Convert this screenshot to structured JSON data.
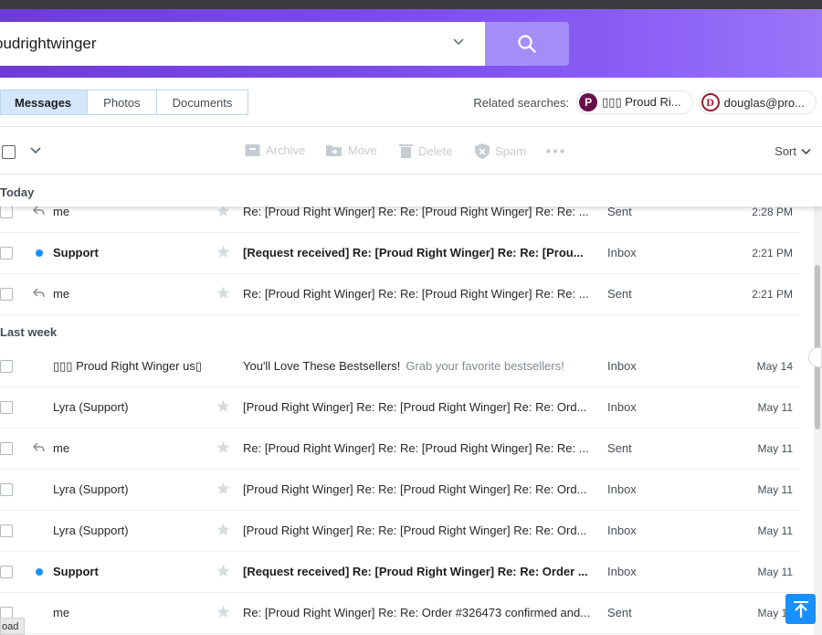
{
  "search": {
    "query": "oudrightwinger",
    "button_icon": "search-icon"
  },
  "tabs": [
    {
      "label": "Messages",
      "active": true
    },
    {
      "label": "Photos",
      "active": false
    },
    {
      "label": "Documents",
      "active": false
    }
  ],
  "related": {
    "label": "Related searches:",
    "chips": [
      {
        "avatar": "P",
        "text": "▯▯▯ Proud Ri..."
      },
      {
        "avatar": "D",
        "text": "douglas@pro..."
      }
    ]
  },
  "toolbar": {
    "archive": "Archive",
    "move": "Move",
    "delete": "Delete",
    "spam": "Spam",
    "sort": "Sort"
  },
  "sections": {
    "today": "Today",
    "last_week": "Last week"
  },
  "messages": [
    {
      "sender": "me",
      "subject": "Re: [Proud Right Winger] Re: Re: [Proud Right Winger] Re: Re: ...",
      "snippet": "",
      "folder": "Sent",
      "time": "2:28 PM",
      "unread": false,
      "icon": "reply-icon"
    },
    {
      "sender": "Support",
      "subject": "[Request received] Re: [Proud Right Winger] Re: Re: [Prou...",
      "snippet": "",
      "folder": "Inbox",
      "time": "2:21 PM",
      "unread": true,
      "icon": "unread-dot"
    },
    {
      "sender": "me",
      "subject": "Re: [Proud Right Winger] Re: Re: [Proud Right Winger] Re: Re: ...",
      "snippet": "",
      "folder": "Sent",
      "time": "2:21 PM",
      "unread": false,
      "icon": "reply-icon"
    },
    {
      "sender": "▯▯▯ Proud Right Winger us▯",
      "subject": "You'll Love These Bestsellers!",
      "snippet": "Grab your favorite bestsellers!",
      "folder": "Inbox",
      "time": "May 14",
      "unread": false,
      "icon": ""
    },
    {
      "sender": "Lyra (Support)",
      "subject": "[Proud Right Winger] Re: Re: [Proud Right Winger] Re: Re: Ord...",
      "snippet": "",
      "folder": "Inbox",
      "time": "May 11",
      "unread": false,
      "icon": ""
    },
    {
      "sender": "me",
      "subject": "Re: [Proud Right Winger] Re: Re: [Proud Right Winger] Re: Re: ...",
      "snippet": "",
      "folder": "Sent",
      "time": "May 11",
      "unread": false,
      "icon": "reply-icon"
    },
    {
      "sender": "Lyra (Support)",
      "subject": "[Proud Right Winger] Re: Re: [Proud Right Winger] Re: Re: Ord...",
      "snippet": "",
      "folder": "Inbox",
      "time": "May 11",
      "unread": false,
      "icon": ""
    },
    {
      "sender": "Lyra (Support)",
      "subject": "[Proud Right Winger] Re: Re: [Proud Right Winger] Re: Re: Ord...",
      "snippet": "",
      "folder": "Inbox",
      "time": "May 11",
      "unread": false,
      "icon": ""
    },
    {
      "sender": "Support",
      "subject": "[Request received] Re: [Proud Right Winger] Re: Re: Order ...",
      "snippet": "",
      "folder": "Inbox",
      "time": "May 11",
      "unread": true,
      "icon": "unread-dot"
    },
    {
      "sender": "me",
      "subject": "Re: [Proud Right Winger] Re: Re: Order #326473 confirmed and...",
      "snippet": "",
      "folder": "Sent",
      "time": "May 11",
      "unread": false,
      "icon": ""
    }
  ],
  "status_tab": "oad",
  "colors": {
    "header_start": "#6e3bd6",
    "header_end": "#9a76f9",
    "search_button": "#a58df7",
    "unread_dot": "#188fff",
    "active_tab": "#d4e7fb"
  }
}
